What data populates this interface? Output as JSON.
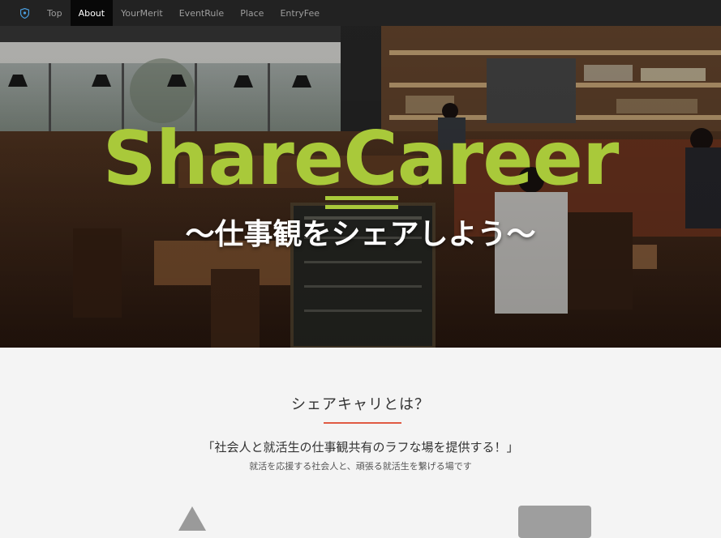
{
  "nav": {
    "brand_icon": "shield-icon",
    "items": [
      {
        "label": "Top",
        "active": false
      },
      {
        "label": "About",
        "active": true
      },
      {
        "label": "YourMerit",
        "active": false
      },
      {
        "label": "EventRule",
        "active": false
      },
      {
        "label": "Place",
        "active": false
      },
      {
        "label": "EntryFee",
        "active": false
      }
    ]
  },
  "hero": {
    "title": "ShareCareer",
    "subtitle": "〜仕事観をシェアしよう〜",
    "title_color": "#a9c93a"
  },
  "about": {
    "heading": "シェアキャリとは？",
    "lead": "「社会人と就活生の仕事観共有のラフな場を提供する！」",
    "description": "就活を応援する社会人と、頑張る就活生を繋げる場です",
    "accent_color": "#e05a43"
  }
}
